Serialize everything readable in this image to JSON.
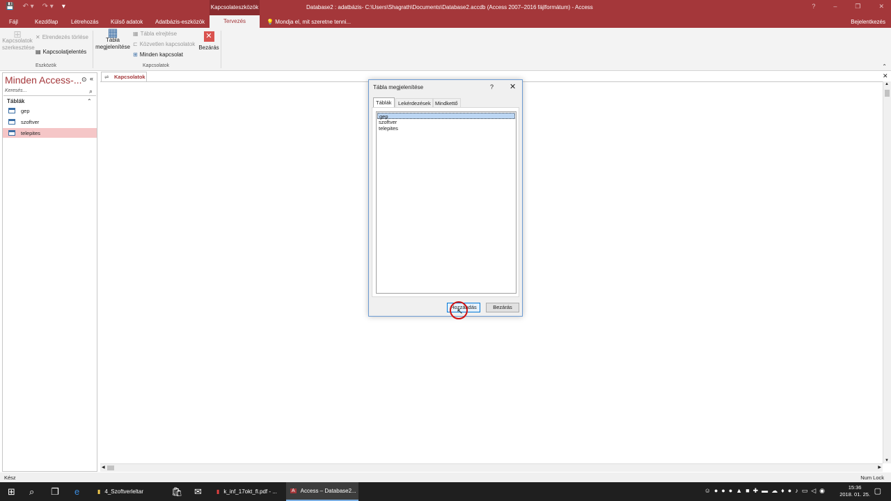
{
  "titlebar": {
    "contextual_tools": "Kapcsolateszközök",
    "title": "Database2 : adatbázis- C:\\Users\\Shagrath\\Documents\\Database2.accdb (Access 2007–2016 fájlformátum) - Access",
    "help": "?",
    "minimize": "–",
    "restore": "❐",
    "close": "✕"
  },
  "ribbon_tabs": {
    "file": "Fájl",
    "home": "Kezdőlap",
    "create": "Létrehozás",
    "external": "Külső adatok",
    "dbtools": "Adatbázis-eszközök",
    "design": "Tervezés",
    "tell_me": "Mondja el, mit szeretne tenni...",
    "sign_in": "Bejelentkezés"
  },
  "ribbon": {
    "edit_relationships": "Kapcsolatok szerkesztése",
    "clear_layout": "Elrendezés törlése",
    "relationship_report": "Kapcsolatjelentés",
    "tools_group": "Eszközök",
    "show_table": "Tábla megjelenítése",
    "hide_table": "Tábla elrejtése",
    "direct_relationships": "Közvetlen kapcsolatok",
    "all_relationships": "Minden kapcsolat",
    "close": "Bezárás",
    "relationships_group": "Kapcsolatok"
  },
  "nav": {
    "title": "Minden Access-...",
    "search_placeholder": "Keresés...",
    "section": "Táblák",
    "items": [
      {
        "label": "gep"
      },
      {
        "label": "szoftver"
      },
      {
        "label": "telepites"
      }
    ]
  },
  "doc_tab": {
    "label": "Kapcsolatok"
  },
  "dialog": {
    "title": "Tábla megjelenítése",
    "help": "?",
    "close": "✕",
    "tabs": [
      "Táblák",
      "Lekérdezések",
      "Mindkettő"
    ],
    "list": [
      "gep",
      "szoftver",
      "telepites"
    ],
    "add_button": "Hozzáadás",
    "close_button": "Bezárás"
  },
  "status": {
    "left": "Kész",
    "right": "Num Lock"
  },
  "taskbar": {
    "apps": [
      {
        "label": "4_Szoftverleltar"
      },
      {
        "label": "k_inf_17okt_fl.pdf - ..."
      },
      {
        "label": "Access – Database2..."
      }
    ],
    "time": "15:36",
    "date": "2018. 01. 25."
  },
  "colors": {
    "accent": "#a4373a",
    "selection": "#f5c6c7"
  }
}
